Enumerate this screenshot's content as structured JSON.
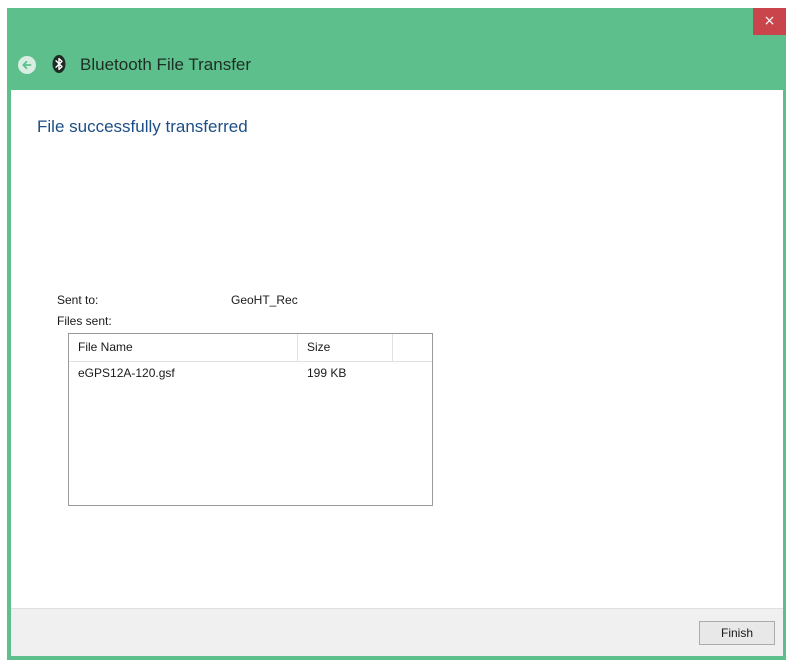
{
  "window": {
    "title": "Bluetooth File Transfer",
    "close_label": "×",
    "frame_color": "#5dbf8b",
    "close_color": "#c9454b"
  },
  "content": {
    "heading": "File successfully transferred",
    "heading_color": "#1c4f86",
    "sent_to_label": "Sent to:",
    "sent_to_value": "GeoHT_Rec",
    "files_sent_label": "Files sent:"
  },
  "file_list": {
    "columns": [
      "File Name",
      "Size",
      ""
    ],
    "rows": [
      {
        "name": "eGPS12A-120.gsf",
        "size": "199 KB"
      }
    ]
  },
  "footer": {
    "finish_label": "Finish"
  },
  "icons": {
    "back": "back-arrow-icon",
    "bluetooth": "bluetooth-icon"
  }
}
